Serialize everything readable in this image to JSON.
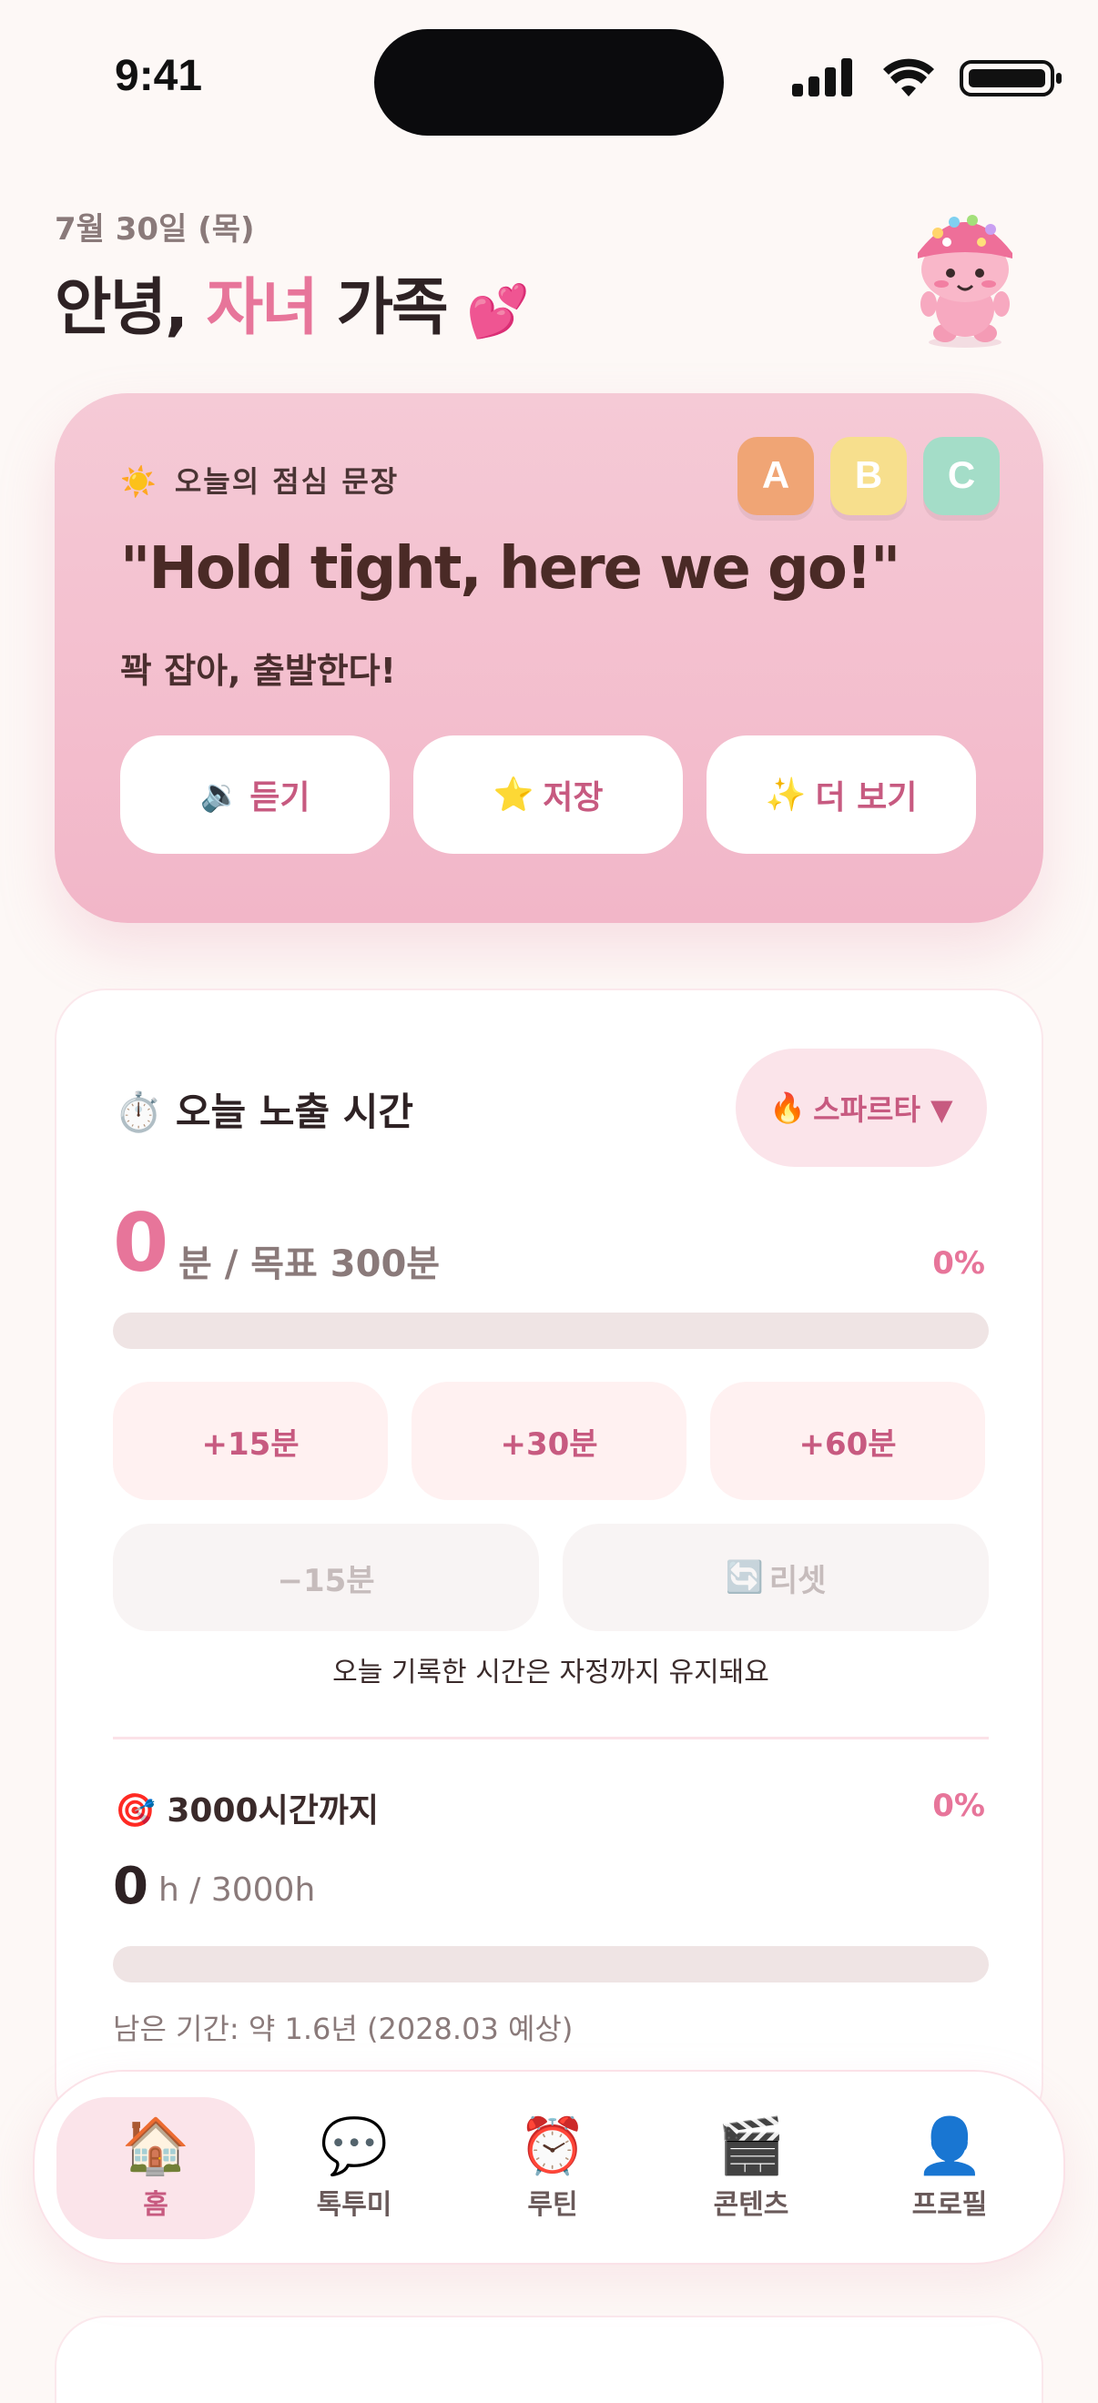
{
  "status_bar": {
    "time": "9:41"
  },
  "header": {
    "date": "7월 30일 (목)",
    "greeting_prefix": "안녕,",
    "greeting_highlight": "자녀",
    "greeting_suffix": "가족",
    "greeting_emoji": "💕"
  },
  "phrase_card": {
    "label_icon": "☀️",
    "label": "오늘의 점심 문장",
    "level_badges": [
      "A",
      "B",
      "C"
    ],
    "english": "\"Hold tight, here we go!\"",
    "korean": "꽉 잡아, 출발한다!",
    "buttons": [
      {
        "icon": "🔉",
        "label": "듣기"
      },
      {
        "icon": "⭐",
        "label": "저장"
      },
      {
        "icon": "✨",
        "label": "더 보기"
      }
    ]
  },
  "exposure": {
    "title_icon": "⏱️",
    "title": "오늘 노출 시간",
    "mode_icon": "🔥",
    "mode_label": "스파르타 ▼",
    "minutes_value": "0",
    "minutes_goal": "분 / 목표 300분",
    "percent_today": "0%",
    "progress_today": 0,
    "add_buttons": [
      "+15분",
      "+30분",
      "+60분"
    ],
    "subtract_button": "−15분",
    "reset_icon": "🔄",
    "reset_button": "리셋",
    "note": "오늘 기록한 시간은 자정까지 유지돼요",
    "goal_icon": "🎯",
    "goal_title": "3000시간까지",
    "percent_total": "0%",
    "hours_value": "0",
    "hours_goal": "h / 3000h",
    "progress_total": 0,
    "remaining": "남은 기간: 약 1.6년 (2028.03 예상)"
  },
  "nav": {
    "items": [
      {
        "icon": "🏠",
        "label": "홈",
        "active": true
      },
      {
        "icon": "💬",
        "label": "톡투미",
        "active": false
      },
      {
        "icon": "⏰",
        "label": "루틴",
        "active": false
      },
      {
        "icon": "🎬",
        "label": "콘텐츠",
        "active": false
      },
      {
        "icon": "👤",
        "label": "프로필",
        "active": false
      }
    ]
  },
  "colors": {
    "accent": "#e7759a",
    "accent_dark": "#c75a80",
    "card_pink": "#f2b6c8",
    "background": "#fdf8f6"
  }
}
